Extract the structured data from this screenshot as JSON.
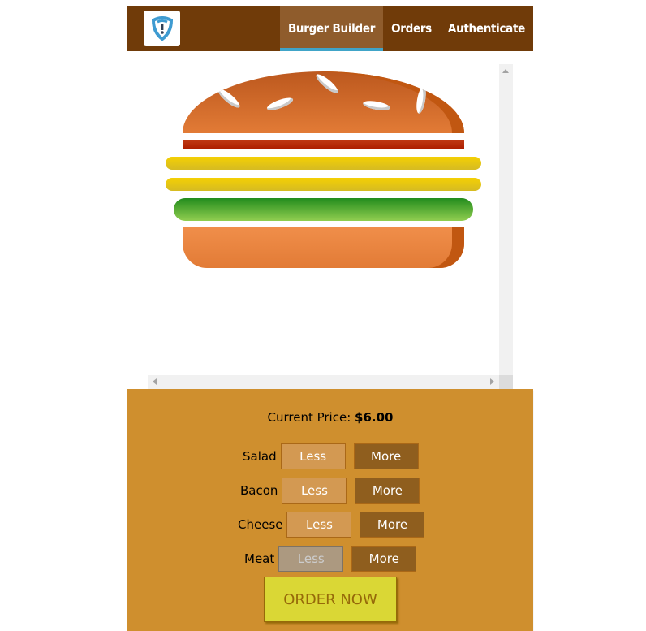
{
  "nav": {
    "logo_icon": "shield-logo-icon",
    "items": [
      {
        "label": "Burger Builder",
        "active": true
      },
      {
        "label": "Orders",
        "active": false
      },
      {
        "label": "Authenticate",
        "active": false
      }
    ]
  },
  "burger": {
    "ingredients": [
      "bread-top",
      "bacon",
      "cheese",
      "cheese",
      "salad",
      "bread-bottom"
    ]
  },
  "controls": {
    "price_label": "Current Price:",
    "price_value": "$6.00",
    "rows": [
      {
        "label": "Salad",
        "less": "Less",
        "more": "More",
        "less_disabled": false
      },
      {
        "label": "Bacon",
        "less": "Less",
        "more": "More",
        "less_disabled": false
      },
      {
        "label": "Cheese",
        "less": "Less",
        "more": "More",
        "less_disabled": false
      },
      {
        "label": "Meat",
        "less": "Less",
        "more": "More",
        "less_disabled": true
      }
    ],
    "order_label": "ORDER NOW"
  },
  "colors": {
    "toolbar": "#703B09",
    "nav_active": "#8F5C2C",
    "nav_underline": "#40A4C8",
    "controls_bg": "#CF8F2E",
    "order_bg": "#DAD735"
  }
}
